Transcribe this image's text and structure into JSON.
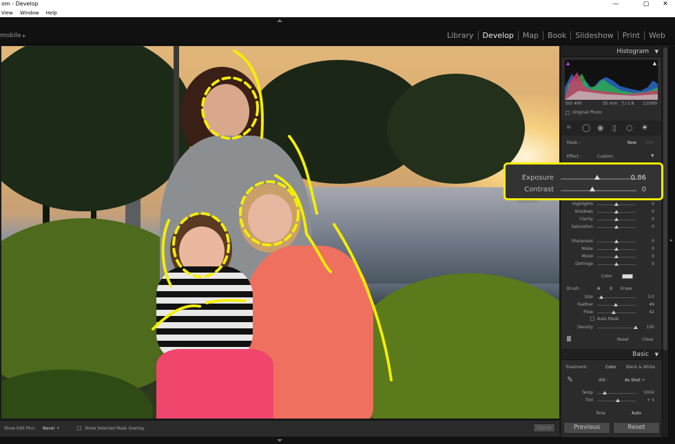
{
  "window": {
    "title": "om - Develop",
    "menu": [
      "View",
      "Window",
      "Help"
    ],
    "controls": {
      "minimize": "—",
      "maximize": "▢",
      "close": "✕"
    }
  },
  "identity": {
    "label": "mobile"
  },
  "modules": [
    "Library",
    "Develop",
    "Map",
    "Book",
    "Slideshow",
    "Print",
    "Web"
  ],
  "active_module": "Develop",
  "histogram": {
    "title": "Histogram",
    "iso": "ISO 400",
    "focal": "35 mm",
    "aperture": "ƒ / 2.8",
    "shutter": "1/1000",
    "original_photo": "Original Photo"
  },
  "mask": {
    "label": "Mask :",
    "new": "New",
    "edit": "Edit"
  },
  "effect": {
    "label": "Effect :",
    "value": "Custom"
  },
  "callout": {
    "exposure_label": "Exposure",
    "exposure_value": "0.86",
    "exposure_frac": 0.48,
    "contrast_label": "Contrast",
    "contrast_value": "0",
    "contrast_frac": 0.42
  },
  "hidden_row": "Highlights",
  "sliders": [
    {
      "label": "Highlights",
      "value": "0",
      "frac": 0.5
    },
    {
      "label": "Shadows",
      "value": "0",
      "frac": 0.5
    },
    {
      "label": "Clarity",
      "value": "0",
      "frac": 0.5
    },
    {
      "label": "Saturation",
      "value": "0",
      "frac": 0.5
    },
    {
      "label": "Sharpness",
      "value": "0",
      "frac": 0.5
    },
    {
      "label": "Noise",
      "value": "0",
      "frac": 0.5
    },
    {
      "label": "Moiré",
      "value": "0",
      "frac": 0.5
    },
    {
      "label": "Defringe",
      "value": "0",
      "frac": 0.5
    }
  ],
  "color_label": "Color",
  "brush": {
    "label": "Brush :",
    "a": "A",
    "b": "B",
    "erase": "Erase",
    "size_label": "Size",
    "size_value": "3.0",
    "size_frac": 0.1,
    "feather_label": "Feather",
    "feather_value": "49",
    "feather_frac": 0.49,
    "flow_label": "Flow",
    "flow_value": "42",
    "flow_frac": 0.42,
    "automask": "Auto Mask",
    "density_label": "Density",
    "density_value": "100",
    "density_frac": 1.0
  },
  "panel_buttons": {
    "reset": "Reset",
    "close": "Close"
  },
  "basic": {
    "title": "Basic",
    "treatment_label": "Treatment :",
    "color": "Color",
    "bw": "Black & White",
    "wb_label": "WB :",
    "wb_value": "As Shot ÷",
    "temp_label": "Temp",
    "temp_value": "5050",
    "temp_frac": 0.2,
    "tint_label": "Tint",
    "tint_value": "+ 5",
    "tint_frac": 0.53,
    "tone_label": "Tone",
    "auto": "Auto"
  },
  "bottom": {
    "show_pins_label": "Show Edit Pins :",
    "show_pins_value": "Never ÷",
    "overlay": "Show Selected Mask Overlay",
    "done": "Done"
  },
  "footer": {
    "previous": "Previous",
    "reset": "Reset"
  },
  "colors": {
    "highlight": "#f4ee00",
    "panel": "#2b2b2b",
    "accent": "#eeeeee"
  }
}
